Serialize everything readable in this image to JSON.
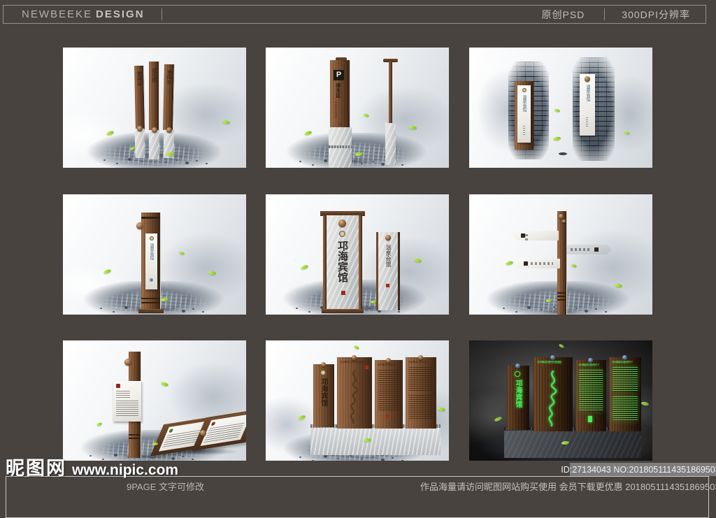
{
  "header": {
    "brand": "NEWBEEKE",
    "brand_bold": "DESIGN",
    "badge_psd": "原创PSD",
    "badge_dpi": "300DPI分辨率"
  },
  "watermark": {
    "logo": "昵图网",
    "url": "www.nipic.com"
  },
  "meta_bar": {
    "id_no": "ID:27134043 NO:20180511143518695036"
  },
  "bottom_strip": {
    "left": "9PAGE 文字可修改",
    "right": "作品海量请访问昵图网站购买使用 会员下载更优惠 20180511143518695036"
  },
  "panels": {
    "p1": {
      "steles": [
        "壹肆柒",
        "贰伍捌",
        "叁陆玖"
      ]
    },
    "p2": {
      "p": "P",
      "label": "停车区",
      "arrow": "→"
    },
    "p3": {
      "sign_left": "温泉会馆",
      "sign_right": "温泉会馆"
    },
    "p4": {
      "sign": "温泉会馆"
    },
    "p5": {
      "main": "邛海宾馆",
      "side": "温泉会馆"
    },
    "p8": {
      "title": "邛海宾馆",
      "h_map": "邛海宾馆导视图",
      "h_intro1": "邛海宾馆简介",
      "h_intro2": "邛海宾馆简介"
    },
    "p9": {
      "title": "邛海宾馆",
      "h_map": "邛海宾馆导视图",
      "h_intro1": "邛海宾馆简介",
      "h_intro2": "邛海宾馆简介"
    }
  },
  "colors": {
    "background": "#48433f",
    "wood_brown": "#7d5434",
    "leaf_green": "#8fd32f",
    "glow_green": "#3fe151",
    "meta_bar_gray": "#7d7d7d"
  }
}
